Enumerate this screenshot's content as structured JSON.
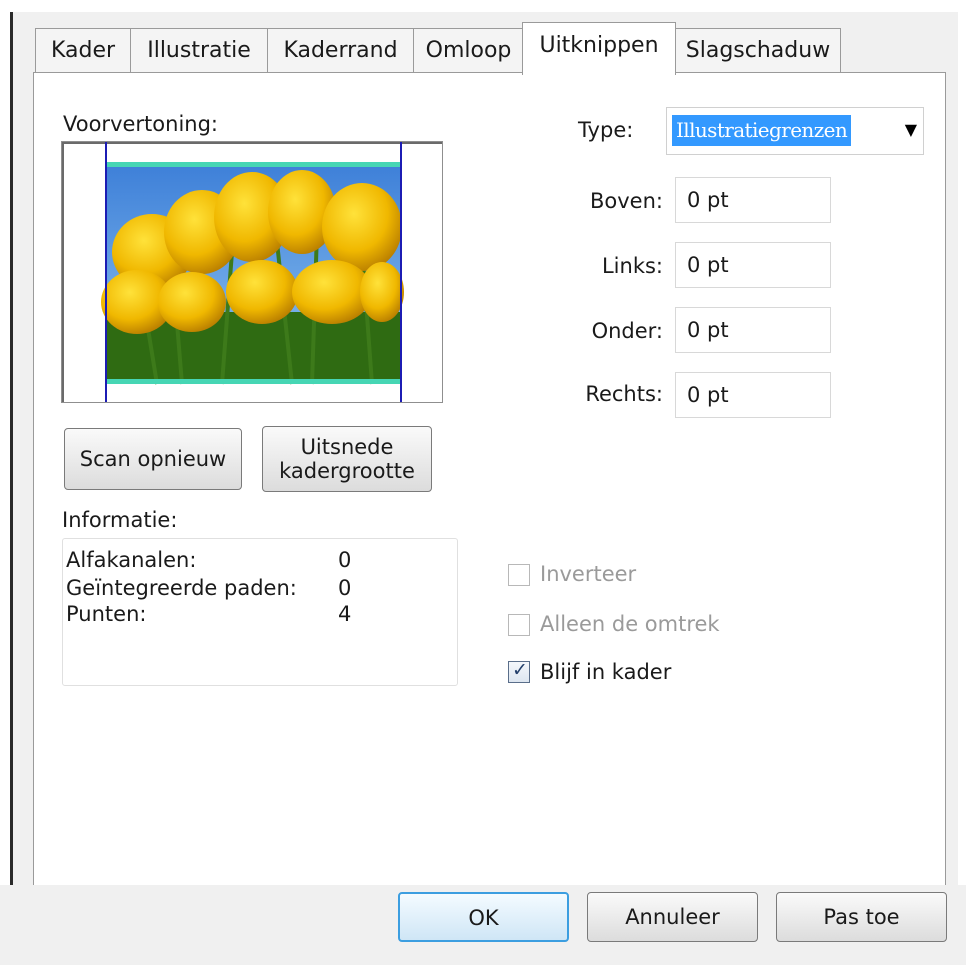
{
  "tabs": [
    {
      "label": "Kader"
    },
    {
      "label": "Illustratie"
    },
    {
      "label": "Kaderrand"
    },
    {
      "label": "Omloop"
    },
    {
      "label": "Uitknippen"
    },
    {
      "label": "Slagschaduw"
    }
  ],
  "active_tab": "Uitknippen",
  "preview": {
    "label": "Voorvertoning:"
  },
  "type": {
    "label": "Type:",
    "value": "Illustratiegrenzen"
  },
  "fields": {
    "boven": {
      "label": "Boven:",
      "value": "0 pt"
    },
    "links": {
      "label": "Links:",
      "value": "0 pt"
    },
    "onder": {
      "label": "Onder:",
      "value": "0 pt"
    },
    "rechts": {
      "label": "Rechts:",
      "value": "0 pt"
    }
  },
  "buttons": {
    "scan": "Scan opnieuw",
    "uitsnede_line1": "Uitsnede",
    "uitsnede_line2": "kadergrootte",
    "ok": "OK",
    "annuleer": "Annuleer",
    "pastoe": "Pas toe"
  },
  "info": {
    "title": "Informatie:",
    "rows": [
      {
        "label": "Alfakanalen:",
        "value": "0"
      },
      {
        "label": "Geïntegreerde paden:",
        "value": "0"
      },
      {
        "label": "Punten:",
        "value": "4"
      }
    ]
  },
  "checkboxes": [
    {
      "label": "Inverteer",
      "checked": false,
      "enabled": false
    },
    {
      "label": "Alleen de omtrek",
      "checked": false,
      "enabled": false
    },
    {
      "label": "Blijf in kader",
      "checked": true,
      "enabled": true
    }
  ],
  "colors": {
    "selection": "#3399ff",
    "guide": "#1c1cb4",
    "clip": "#46d6b4"
  }
}
